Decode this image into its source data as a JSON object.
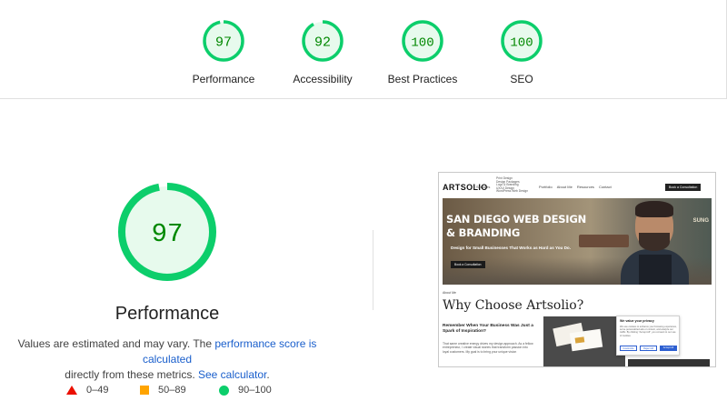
{
  "summary": {
    "gauges": [
      {
        "score": "97",
        "label": "Performance"
      },
      {
        "score": "92",
        "label": "Accessibility"
      },
      {
        "score": "100",
        "label": "Best Practices"
      },
      {
        "score": "100",
        "label": "SEO"
      }
    ]
  },
  "main": {
    "score": "97",
    "title": "Performance",
    "note_prefix": "Values are estimated and may vary. The ",
    "note_link1": "performance score is calculated",
    "note_middle": " directly from these metrics. ",
    "note_link2": "See calculator",
    "note_suffix": "."
  },
  "legend": [
    {
      "range": "0–49",
      "shape": "triangle",
      "color": "#eb0f00"
    },
    {
      "range": "50–89",
      "shape": "square",
      "color": "#ffa400"
    },
    {
      "range": "90–100",
      "shape": "circle",
      "color": "#0cce6b"
    }
  ],
  "thumbnail": {
    "logo": "ARTSOLIO",
    "nav_services": "Services",
    "submenu": [
      "Print Design",
      "Design Packages",
      "Logo & Branding",
      "UX/UI Design",
      "WordPress Web Design"
    ],
    "nav_links": [
      "Portfolio",
      "About Me",
      "Resources",
      "Contact"
    ],
    "nav_cta": "Book a Consultation",
    "hero_line1": "SAN DIEGO WEB DESIGN",
    "hero_line2": "& BRANDING",
    "hero_sub": "Design for Small Businesses That Works as Hard as You Do.",
    "hero_btn": "Book a Consultation",
    "hero_sign": "SUNG",
    "about": "About Me",
    "why": "Why Choose Artsolio?",
    "remember": "Remember When Your Business Was Just a Spark of Inspiration?",
    "body": "That same creative energy drives my design approach. As a fellow entrepreneur, I create visual stories that transform passion into loyal customers. My goal is to bring your unique vision",
    "cookie_title": "We value your privacy",
    "cookie_text": "We use cookies to enhance your browsing experience, serve personalized ads or content, and analyze our traffic. By clicking \"Accept All\", you consent to our use of cookies.",
    "cookie_btn1": "Customize",
    "cookie_btn2": "Reject All",
    "cookie_btn3": "Accept All"
  },
  "colors": {
    "pass": "#0cce6b",
    "pass_text": "#008800",
    "pass_fill": "#e7faed",
    "link": "#1a5fcc"
  }
}
